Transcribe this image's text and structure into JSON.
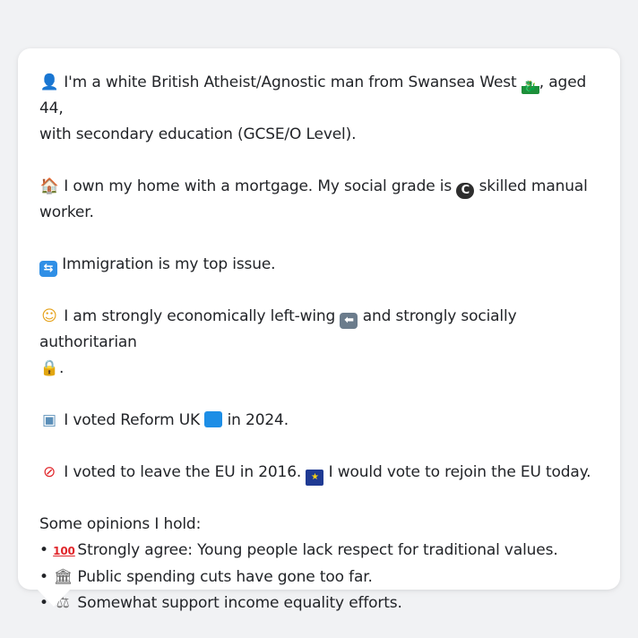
{
  "profile": {
    "p1": {
      "emoji": "👤",
      "text1": "I'm a white British Atheist/Agnostic man from Swansea West",
      "flag": "🏴",
      "text2": ", aged 44,",
      "text3": "with secondary education (GCSE/O Level)."
    },
    "p2": {
      "emoji": "🏠",
      "text1": "I own my home with a mortgage. My social grade is",
      "grade_icon": "C",
      "text2": "skilled manual",
      "text3": "worker."
    },
    "p3": {
      "emoji": "🛂",
      "text": "Immigration is my top issue."
    },
    "p4": {
      "emoji": "🤔",
      "text1": "I am strongly economically left-wing",
      "left_icon": "⬅",
      "text2": "and strongly socially authoritarian",
      "lock_icon": "🔒",
      "text3": "."
    },
    "p5": {
      "emoji": "🗳",
      "text1": "I voted Reform UK",
      "text2": "in 2024."
    },
    "p6": {
      "emoji": "🚫",
      "text1": "I voted to leave the EU in 2016.",
      "eu_flag": "★",
      "text2": "I would vote to rejoin the EU today."
    },
    "opinions": {
      "heading": "Some opinions I hold:",
      "items": [
        {
          "bullet": "•",
          "emoji": "💯",
          "text": "Strongly agree: Young people lack respect for traditional values."
        },
        {
          "bullet": "•",
          "emoji": "🏛",
          "text": "Public spending cuts have gone too far."
        },
        {
          "bullet": "•",
          "emoji": "⚖",
          "text": "Somewhat support income equality efforts."
        }
      ]
    }
  },
  "colors": {
    "background": "#f1f2f4",
    "card": "#ffffff",
    "text": "#222428",
    "reform": "#1d8ee6"
  }
}
